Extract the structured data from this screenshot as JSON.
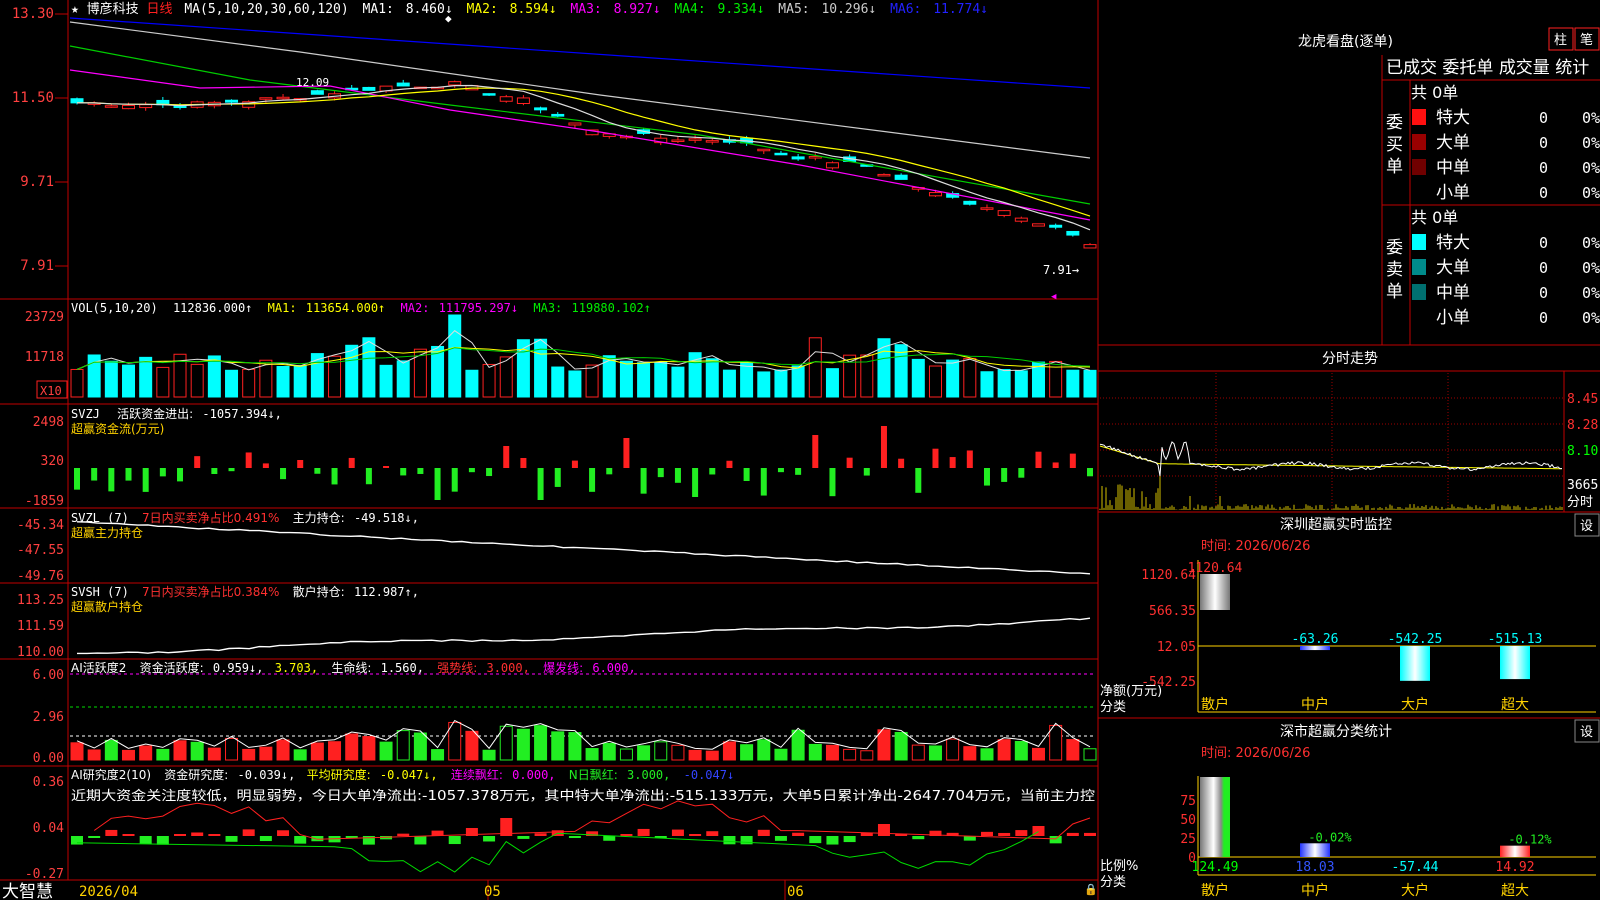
{
  "app": {
    "brand": "大智慧"
  },
  "colors": {
    "up": "#ff2020",
    "down": "#00ffff",
    "ma1": "#dddddd",
    "ma2": "#ffff00",
    "ma3": "#ff00ff",
    "ma4": "#00cc00",
    "ma5": "#cccccc",
    "ma6": "#0000ff",
    "label": "#ff4040",
    "yellow": "#ffd200",
    "green": "#22ee22",
    "white": "#ffffff"
  },
  "main": {
    "stock_name": "博彦科技",
    "period": "日线",
    "ma_params": "MA(5,10,20,30,60,120)",
    "ma_values": [
      {
        "label": "MA1:",
        "value": "8.460↓"
      },
      {
        "label": "MA2:",
        "value": "8.594↓"
      },
      {
        "label": "MA3:",
        "value": "8.927↓"
      },
      {
        "label": "MA4:",
        "value": "9.334↓"
      },
      {
        "label": "MA5:",
        "value": "10.296↓"
      },
      {
        "label": "MA6:",
        "value": "11.774↓"
      }
    ],
    "y_ticks": [
      "13.30",
      "11.50",
      "9.71",
      "7.91"
    ],
    "last_price_label": "7.91→",
    "peak_label": "12.09"
  },
  "vol": {
    "title": "VOL(5,10,20)",
    "value": "112836.000↑",
    "mas": [
      {
        "label": "MA1:",
        "value": "113654.000↑"
      },
      {
        "label": "MA2:",
        "value": "111795.297↓"
      },
      {
        "label": "MA3:",
        "value": "119880.102↑"
      }
    ],
    "y_ticks": [
      "23729",
      "11718"
    ],
    "unit": "X10"
  },
  "svzj": {
    "title": "SVZJ",
    "label": "活跃资金进出:",
    "value": "-1057.394↓,",
    "subtitle": "超赢资金流(万元)",
    "y_ticks": [
      "2498",
      "320",
      "-1859"
    ]
  },
  "svzl": {
    "title": "SVZL (7)",
    "ratio": "7日内买卖净占比0.491%",
    "label": "主力持仓:",
    "value": "-49.518↓,",
    "subtitle": "超赢主力持仓",
    "y_ticks": [
      "-45.34",
      "-47.55",
      "-49.76"
    ]
  },
  "svsh": {
    "title": "SVSH (7)",
    "ratio": "7日内买卖净占比0.384%",
    "label": "散户持仓:",
    "value": "112.987↑,",
    "subtitle": "超赢散户持仓",
    "y_ticks": [
      "113.25",
      "111.59",
      "110.00"
    ]
  },
  "ai_act": {
    "title": "AI活跃度2",
    "label": "资金活跃度:",
    "v1": "0.959↓,",
    "v2": "3.703,",
    "life_label": "生命线:",
    "life_value": "1.560,",
    "strong_label": "强势线:",
    "strong_value": "3.000,",
    "burst_label": "爆发线:",
    "burst_value": "6.000,",
    "y_ticks": [
      "6.00",
      "2.96",
      "0.00"
    ]
  },
  "ai_res": {
    "title": "AI研究度2(10)",
    "label": "资金研究度:",
    "v1": "-0.039↓,",
    "avg_label": "平均研究度:",
    "avg_value": "-0.047↓,",
    "cont_label": "连续飘红:",
    "cont_value": "0.000,",
    "n_label": "N日飘红:",
    "n_value": "3.000,",
    "tail": "-0.047↓",
    "desc": "近期大资金关注度较低，明显弱势，今日大单净流出:-1057.378万元，其中特大单净流出:-515.133万元，大单5日累计净出-2647.704万元，当前主力控",
    "y_ticks": [
      "0.36",
      "0.04",
      "-0.27"
    ]
  },
  "dates": [
    "2026/04",
    "05",
    "06"
  ],
  "longhu": {
    "title": "龙虎看盘(逐单)",
    "btn1": "柱",
    "btn2": "笔",
    "tabs": [
      "已成交",
      "委托单",
      "成交量",
      "统计"
    ],
    "buy_label": "委买单",
    "sell_label": "委卖单",
    "buy": {
      "total": "共 0单",
      "rows": [
        {
          "name": "特大",
          "count": "0",
          "pct": "0%"
        },
        {
          "name": "大单",
          "count": "0",
          "pct": "0%"
        },
        {
          "name": "中单",
          "count": "0",
          "pct": "0%"
        },
        {
          "name": "小单",
          "count": "0",
          "pct": "0%"
        }
      ]
    },
    "sell": {
      "total": "共 0单",
      "rows": [
        {
          "name": "特大",
          "count": "0",
          "pct": "0%"
        },
        {
          "name": "大单",
          "count": "0",
          "pct": "0%"
        },
        {
          "name": "中单",
          "count": "0",
          "pct": "0%"
        },
        {
          "name": "小单",
          "count": "0",
          "pct": "0%"
        }
      ]
    }
  },
  "intraday": {
    "title": "分时走势",
    "y_ticks": [
      "8.45",
      "8.28",
      "8.10"
    ],
    "vol_tick": "3665",
    "unit": "分时"
  },
  "monitor": {
    "title": "深圳超赢实时监控",
    "set": "设",
    "time": "时间: 2026/06/26",
    "ylabel": "净额(万元)",
    "xlabel": "分类",
    "y_ticks": [
      "1120.64",
      "566.35",
      "12.05",
      "-542.25"
    ],
    "categories": [
      "散户",
      "中户",
      "大户",
      "超大"
    ],
    "values": [
      1120.64,
      -63.26,
      -542.25,
      -515.13
    ],
    "value_labels": [
      "1120.64",
      "-63.26",
      "-542.25",
      "-515.13"
    ]
  },
  "classstat": {
    "title": "深市超赢分类统计",
    "set": "设",
    "time": "时间: 2026/06/26",
    "ylabel": "比例%",
    "xlabel": "分类",
    "y_ticks": [
      "75",
      "50",
      "25",
      "0"
    ],
    "categories": [
      "散户",
      "中户",
      "大户",
      "超大"
    ],
    "values": [
      124.49,
      18.03,
      -57.44,
      14.92
    ],
    "value_labels": [
      "124.49",
      "18.03",
      "-57.44",
      "14.92"
    ],
    "pct_labels": [
      "",
      "-0.02%",
      "",
      "-0.12%"
    ]
  }
}
